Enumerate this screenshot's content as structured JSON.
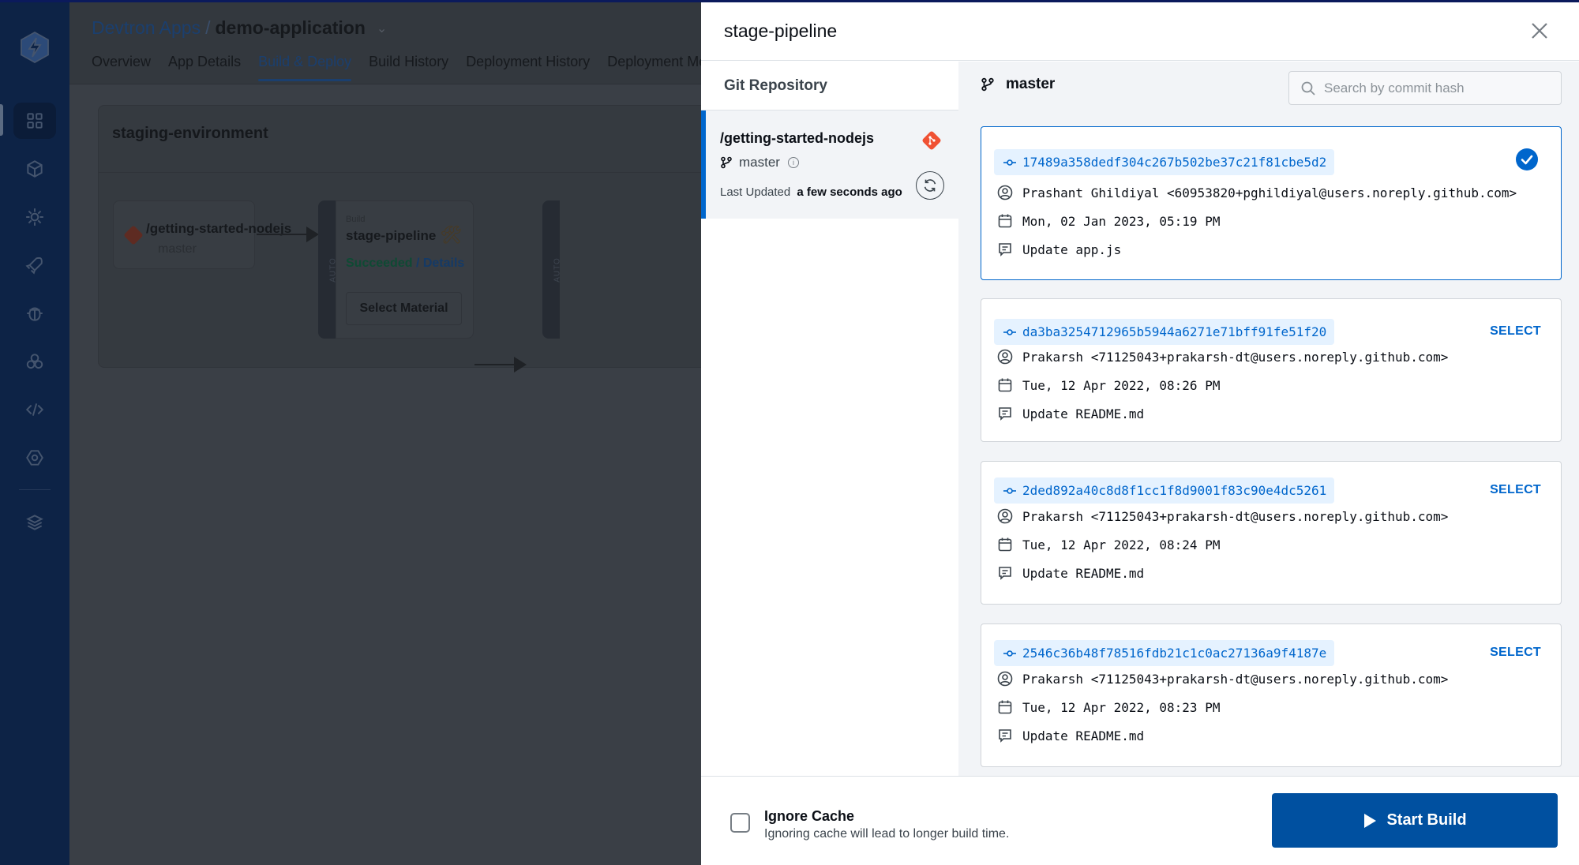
{
  "background": {
    "breadcrumb": {
      "parent": "Devtron Apps",
      "separator": "/",
      "current": "demo-application"
    },
    "tabs": [
      {
        "label": "Overview",
        "active": false
      },
      {
        "label": "App Details",
        "active": false
      },
      {
        "label": "Build & Deploy",
        "active": true
      },
      {
        "label": "Build History",
        "active": false
      },
      {
        "label": "Deployment History",
        "active": false
      },
      {
        "label": "Deployment Metrics",
        "active": false
      }
    ],
    "sidebar_icons": [
      "apps-grid-icon",
      "cube-icon",
      "gear-sun-icon",
      "rocket-icon",
      "bug-icon",
      "cluster-icon",
      "code-icon",
      "settings-icon",
      "stack-icon"
    ],
    "workflow": {
      "name": "staging-environment",
      "git_node": {
        "repo": "/getting-started-nodejs",
        "branch": "master"
      },
      "trigger_type": "AUTO",
      "build_node": {
        "type_label": "Build",
        "name": "stage-pipeline",
        "status": "Succeeded",
        "status_sep": "/",
        "details_link": "Details",
        "select_material_label": "Select Material"
      }
    }
  },
  "drawer": {
    "title": "stage-pipeline",
    "repo_panel": {
      "heading": "Git Repository",
      "repos": [
        {
          "name": "/getting-started-nodejs",
          "branch": "master",
          "last_updated_label": "Last Updated",
          "last_updated_value": "a few seconds ago",
          "selected": true
        }
      ]
    },
    "commit_panel": {
      "branch": "master",
      "search_placeholder": "Search by commit hash",
      "select_label": "SELECT",
      "commits": [
        {
          "hash": "17489a358dedf304c267b502be37c21f81cbe5d2",
          "author": "Prashant Ghildiyal <60953820+pghildiyal@users.noreply.github.com>",
          "date": "Mon, 02 Jan 2023, 05:19 PM",
          "message": "Update app.js",
          "selected": true
        },
        {
          "hash": "da3ba3254712965b5944a6271e71bff91fe51f20",
          "author": "Prakarsh <71125043+prakarsh-dt@users.noreply.github.com>",
          "date": "Tue, 12 Apr 2022, 08:26 PM",
          "message": "Update README.md",
          "selected": false
        },
        {
          "hash": "2ded892a40c8d8f1cc1f8d9001f83c90e4dc5261",
          "author": "Prakarsh <71125043+prakarsh-dt@users.noreply.github.com>",
          "date": "Tue, 12 Apr 2022, 08:24 PM",
          "message": "Update README.md",
          "selected": false
        },
        {
          "hash": "2546c36b48f78516fdb21c1c0ac27136a9f4187e",
          "author": "Prakarsh <71125043+prakarsh-dt@users.noreply.github.com>",
          "date": "Tue, 12 Apr 2022, 08:23 PM",
          "message": "Update README.md",
          "selected": false
        }
      ]
    },
    "footer": {
      "ignore_cache_label": "Ignore Cache",
      "ignore_cache_hint": "Ignoring cache will lead to longer build time.",
      "ignore_cache_checked": false,
      "start_build_label": "Start Build"
    }
  },
  "colors": {
    "accent": "#0066cc",
    "primary_button": "#0050a0",
    "git_orange": "#f05133",
    "success": "#1dad70"
  }
}
